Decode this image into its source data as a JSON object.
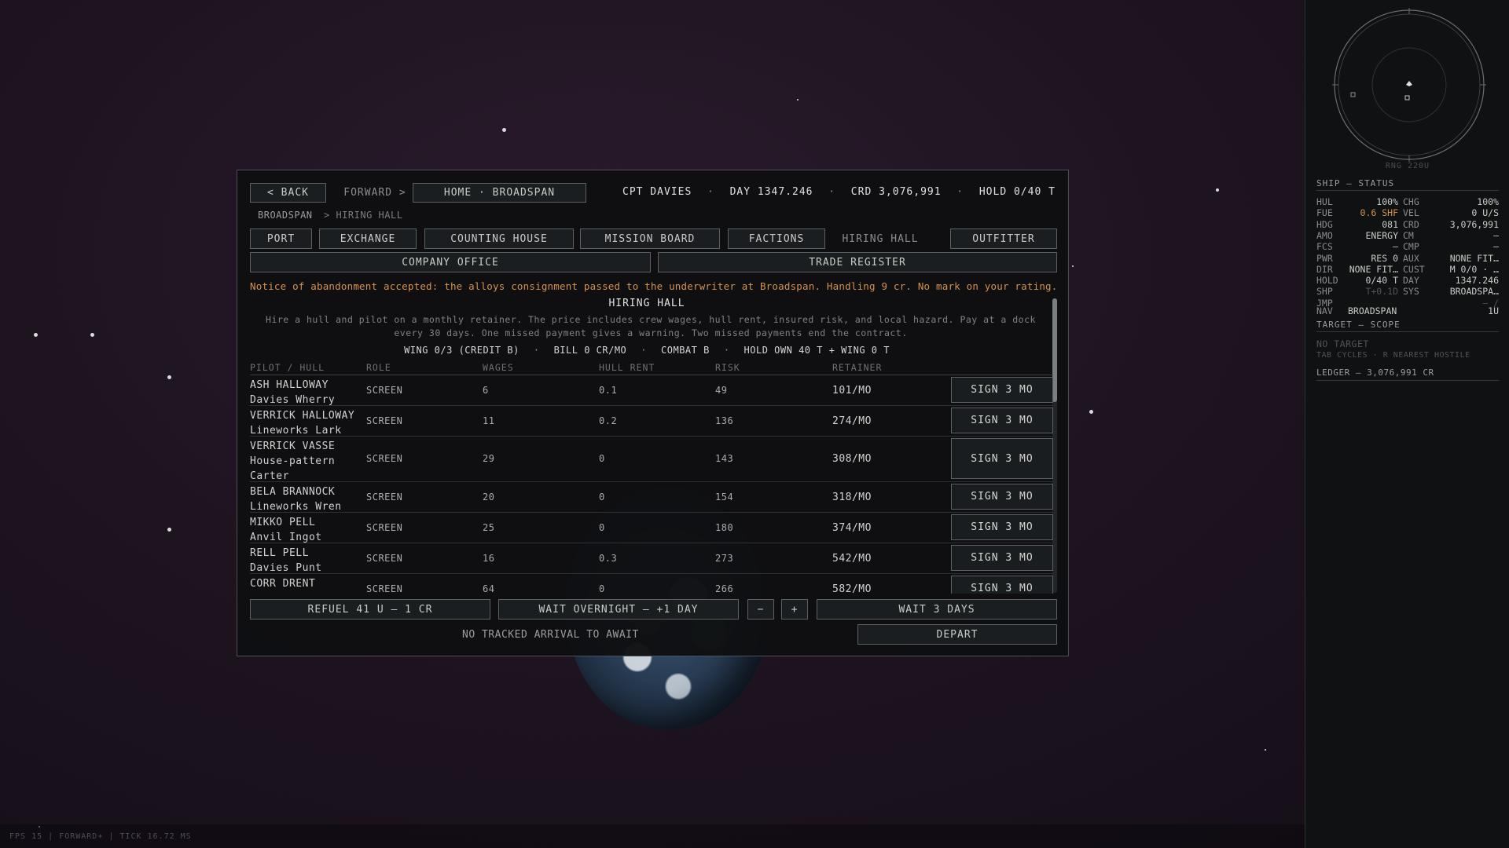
{
  "nav": {
    "back": "< BACK",
    "forward": "FORWARD >",
    "home": "HOME · BROADSPAN"
  },
  "stats": {
    "captain": "CPT DAVIES",
    "day": "DAY 1347.246",
    "credits": "CRD 3,076,991",
    "hold": "HOLD 0/40 T",
    "sep": "·"
  },
  "breadcrumb": {
    "root": "BROADSPAN",
    "current": "> HIRING HALL"
  },
  "tabs": [
    "PORT",
    "EXCHANGE",
    "COUNTING HOUSE",
    "MISSION BOARD",
    "FACTIONS",
    "HIRING HALL",
    "OUTFITTER"
  ],
  "tabs2": [
    "COMPANY OFFICE",
    "TRADE REGISTER"
  ],
  "notice": "Notice of abandonment accepted: the alloys consignment passed to the underwriter at Broadspan. Handling 9 cr. No mark on your rating.",
  "hiring": {
    "title": "HIRING HALL",
    "description": "Hire a hull and pilot on a monthly retainer. The price includes crew wages, hull rent, insured risk, and local hazard. Pay at a dock every 30 days. One missed payment gives a warning. Two missed payments end the contract.",
    "summary": [
      "WING 0/3 (CREDIT B)",
      "BILL 0 CR/MO",
      "COMBAT B",
      "HOLD OWN 40 T + WING 0 T"
    ],
    "columns": [
      "PILOT / HULL",
      "ROLE",
      "WAGES",
      "HULL RENT",
      "RISK",
      "RETAINER"
    ],
    "sign_label": "SIGN 3 MO",
    "rows": [
      {
        "name": "ASH HALLOWAY\nDavies Wherry",
        "role": "SCREEN",
        "wages": "6",
        "hull_rent": "0.1",
        "risk": "49",
        "retainer": "101/MO"
      },
      {
        "name": "VERRICK HALLOWAY\nLineworks Lark",
        "role": "SCREEN",
        "wages": "11",
        "hull_rent": "0.2",
        "risk": "136",
        "retainer": "274/MO"
      },
      {
        "name": "VERRICK VASSE\nHouse-pattern Carter",
        "role": "SCREEN",
        "wages": "29",
        "hull_rent": "0",
        "risk": "143",
        "retainer": "308/MO"
      },
      {
        "name": "BELA BRANNOCK\nLineworks Wren",
        "role": "SCREEN",
        "wages": "20",
        "hull_rent": "0",
        "risk": "154",
        "retainer": "318/MO"
      },
      {
        "name": "MIKKO PELL\nAnvil Ingot",
        "role": "SCREEN",
        "wages": "25",
        "hull_rent": "0",
        "risk": "180",
        "retainer": "374/MO"
      },
      {
        "name": "RELL PELL\nDavies Punt",
        "role": "SCREEN",
        "wages": "16",
        "hull_rent": "0.3",
        "risk": "273",
        "retainer": "542/MO"
      },
      {
        "name": "CORR DRENT\nSable (Recovered)",
        "role": "SCREEN",
        "wages": "64",
        "hull_rent": "0",
        "risk": "266",
        "retainer": "582/MO"
      }
    ]
  },
  "actions": {
    "refuel": "REFUEL 41 U — 1 CR",
    "wait_overnight": "WAIT OVERNIGHT — +1 DAY",
    "minus": "−",
    "plus": "+",
    "wait_days": "WAIT 3 DAYS",
    "no_arrival": "NO TRACKED ARRIVAL TO AWAIT",
    "depart": "DEPART"
  },
  "sidebar": {
    "rng": "RNG 220U",
    "ship_title": "SHIP — STATUS",
    "status": [
      [
        "HUL",
        "100%",
        "CHG",
        "100%"
      ],
      [
        "FUE",
        "0.6 SHF",
        "VEL",
        "0 U/S"
      ],
      [
        "HDG",
        "081",
        "CRD",
        "3,076,991"
      ],
      [
        "AMO",
        "ENERGY",
        "CM",
        "—"
      ],
      [
        "FCS",
        "—",
        "CMP",
        "—"
      ],
      [
        "PWR",
        "RES 0",
        "AUX",
        "NONE FIT…"
      ],
      [
        "DIR",
        "NONE FIT…",
        "CUST",
        "M 0/0 · …"
      ],
      [
        "HOLD",
        "0/40 T",
        "DAY",
        "1347.246"
      ],
      [
        "SHP",
        "T+0.1D",
        "SYS",
        "BROADSPA…"
      ],
      [
        "JMP",
        "",
        "",
        "— /"
      ]
    ],
    "nav_label": "NAV",
    "nav_value": "BROADSPAN",
    "nav_dist": "1U",
    "target_title": "TARGET — SCOPE",
    "no_target": "NO TARGET",
    "tab_hint": "TAB CYCLES · R NEAREST HOSTILE",
    "ledger": "LEDGER — 3,076,991 CR"
  },
  "footer": "FPS 15 | FORWARD+ | TICK 16.72 MS",
  "colors": {
    "notice": "#d6914f",
    "fuel": "#d6914f"
  }
}
